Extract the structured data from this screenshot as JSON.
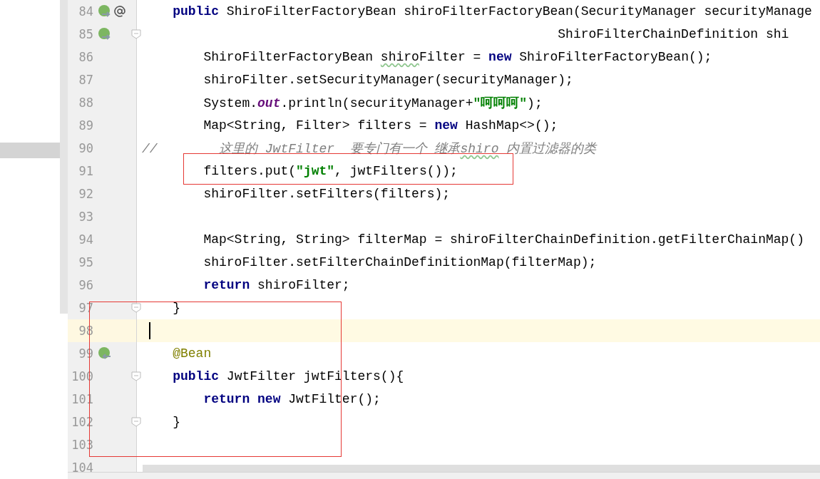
{
  "editor": {
    "lines": [
      {
        "number": "84",
        "gutter_icons": [
          {
            "kind": "bean"
          },
          {
            "kind": "at"
          }
        ],
        "fold": false,
        "current": false,
        "tokens": [
          {
            "kind": "keyword",
            "text": "    public"
          },
          {
            "kind": "plain",
            "text": " ShiroFilterFactoryBean shiroFilterFactoryBean(SecurityManager securityManage"
          }
        ]
      },
      {
        "number": "85",
        "gutter_icons": [
          {
            "kind": "bean"
          }
        ],
        "fold": true,
        "current": false,
        "tokens": [
          {
            "kind": "plain",
            "text": "                                                      ShiroFilterChainDefinition shi"
          }
        ]
      },
      {
        "number": "86",
        "fold": false,
        "current": false,
        "tokens": [
          {
            "kind": "plain",
            "text": "        ShiroFilterFactoryBean "
          },
          {
            "kind": "plain",
            "text": "shiro",
            "typo": true
          },
          {
            "kind": "plain",
            "text": "Filter = "
          },
          {
            "kind": "keyword",
            "text": "new"
          },
          {
            "kind": "plain",
            "text": " ShiroFilterFactoryBean();"
          }
        ]
      },
      {
        "number": "87",
        "fold": false,
        "current": false,
        "tokens": [
          {
            "kind": "plain",
            "text": "        shiroFilter.setSecurityManager(securityManager);"
          }
        ]
      },
      {
        "number": "88",
        "fold": false,
        "current": false,
        "tokens": [
          {
            "kind": "plain",
            "text": "        System."
          },
          {
            "kind": "field",
            "text": "out"
          },
          {
            "kind": "plain",
            "text": ".println(securityManager+"
          },
          {
            "kind": "string",
            "text": "\"呵呵呵\""
          },
          {
            "kind": "plain",
            "text": ");"
          }
        ]
      },
      {
        "number": "89",
        "fold": false,
        "current": false,
        "tokens": [
          {
            "kind": "plain",
            "text": "        Map<String, Filter> filters = "
          },
          {
            "kind": "keyword",
            "text": "new"
          },
          {
            "kind": "plain",
            "text": " HashMap<>();"
          }
        ]
      },
      {
        "number": "90",
        "fold": false,
        "current": false,
        "tokens": [
          {
            "kind": "comment",
            "text": "//        这里的 JwtFilter  要专门有一个 继承"
          },
          {
            "kind": "comment",
            "text": "shiro",
            "typo": true
          },
          {
            "kind": "comment",
            "text": " 内置过滤器的类"
          }
        ]
      },
      {
        "number": "91",
        "fold": false,
        "current": false,
        "tokens": [
          {
            "kind": "plain",
            "text": "        filters.put("
          },
          {
            "kind": "string",
            "text": "\"jwt\""
          },
          {
            "kind": "plain",
            "text": ", jwtFilters());"
          }
        ]
      },
      {
        "number": "92",
        "fold": false,
        "current": false,
        "tokens": [
          {
            "kind": "plain",
            "text": "        shiroFilter.setFilters(filters);"
          }
        ]
      },
      {
        "number": "93",
        "fold": false,
        "current": false
      },
      {
        "number": "94",
        "fold": false,
        "current": false,
        "tokens": [
          {
            "kind": "plain",
            "text": "        Map<String, String> filterMap = shiroFilterChainDefinition.getFilterChainMap()"
          }
        ]
      },
      {
        "number": "95",
        "fold": false,
        "current": false,
        "tokens": [
          {
            "kind": "plain",
            "text": "        shiroFilter.setFilterChainDefinitionMap(filterMap);"
          }
        ]
      },
      {
        "number": "96",
        "fold": false,
        "current": false,
        "tokens": [
          {
            "kind": "keyword",
            "text": "        return"
          },
          {
            "kind": "plain",
            "text": " shiroFilter;"
          }
        ]
      },
      {
        "number": "97",
        "fold": true,
        "current": false,
        "tokens": [
          {
            "kind": "plain",
            "text": "    }"
          }
        ]
      },
      {
        "number": "98",
        "fold": false,
        "current": true
      },
      {
        "number": "99",
        "gutter_icons": [
          {
            "kind": "bean-back"
          }
        ],
        "fold": false,
        "current": false,
        "tokens": [
          {
            "kind": "annotation",
            "text": "    @Bean"
          }
        ]
      },
      {
        "number": "100",
        "fold": true,
        "current": false,
        "tokens": [
          {
            "kind": "keyword",
            "text": "    public"
          },
          {
            "kind": "plain",
            "text": " JwtFilter jwtFilters(){"
          }
        ]
      },
      {
        "number": "101",
        "fold": false,
        "current": false,
        "tokens": [
          {
            "kind": "keyword",
            "text": "        return new"
          },
          {
            "kind": "plain",
            "text": " JwtFilter();"
          }
        ]
      },
      {
        "number": "102",
        "fold": true,
        "current": false,
        "tokens": [
          {
            "kind": "plain",
            "text": "    }"
          }
        ]
      },
      {
        "number": "103",
        "fold": false,
        "current": false
      },
      {
        "number": "104",
        "fold": false,
        "current": false
      }
    ]
  }
}
